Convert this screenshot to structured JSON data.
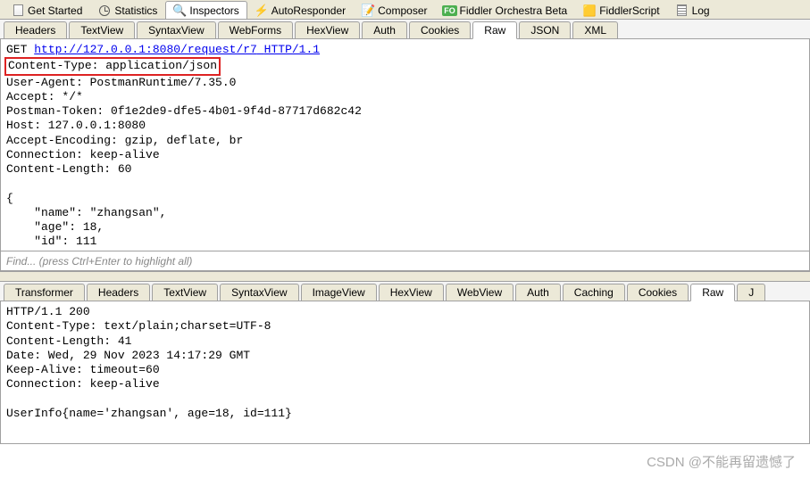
{
  "mainTabs": {
    "getStarted": "Get Started",
    "statistics": "Statistics",
    "inspectors": "Inspectors",
    "autoResponder": "AutoResponder",
    "composer": "Composer",
    "orchestra": "Fiddler Orchestra Beta",
    "fiddlerScript": "FiddlerScript",
    "log": "Log"
  },
  "reqTabs": {
    "headers": "Headers",
    "textView": "TextView",
    "syntaxView": "SyntaxView",
    "webForms": "WebForms",
    "hexView": "HexView",
    "auth": "Auth",
    "cookies": "Cookies",
    "raw": "Raw",
    "json": "JSON",
    "xml": "XML"
  },
  "request": {
    "method": "GET",
    "url": "http://127.0.0.1:8080/request/r7",
    "protocol": "HTTP/1.1",
    "contentType": "Content-Type: application/json",
    "userAgent": "User-Agent: PostmanRuntime/7.35.0",
    "accept": "Accept: */*",
    "postmanToken": "Postman-Token: 0f1e2de9-dfe5-4b01-9f4d-87717d682c42",
    "host": "Host: 127.0.0.1:8080",
    "acceptEncoding": "Accept-Encoding: gzip, deflate, br",
    "connection": "Connection: keep-alive",
    "contentLength": "Content-Length: 60",
    "bodyOpen": "{",
    "bodyName": "    \"name\": \"zhangsan\",",
    "bodyAge": "    \"age\": 18,",
    "bodyId": "    \"id\": 111",
    "bodyClose": "}"
  },
  "findPlaceholder": "Find... (press Ctrl+Enter to highlight all)",
  "respTabs": {
    "transformer": "Transformer",
    "headers": "Headers",
    "textView": "TextView",
    "syntaxView": "SyntaxView",
    "imageView": "ImageView",
    "hexView": "HexView",
    "webView": "WebView",
    "auth": "Auth",
    "caching": "Caching",
    "cookies": "Cookies",
    "raw": "Raw",
    "json": "J"
  },
  "response": {
    "status": "HTTP/1.1 200",
    "contentType": "Content-Type: text/plain;charset=UTF-8",
    "contentLength": "Content-Length: 41",
    "date": "Date: Wed, 29 Nov 2023 14:17:29 GMT",
    "keepAlive": "Keep-Alive: timeout=60",
    "connection": "Connection: keep-alive",
    "blank": "",
    "body": "UserInfo{name='zhangsan', age=18, id=111}"
  },
  "watermark": "CSDN @不能再留遗憾了"
}
